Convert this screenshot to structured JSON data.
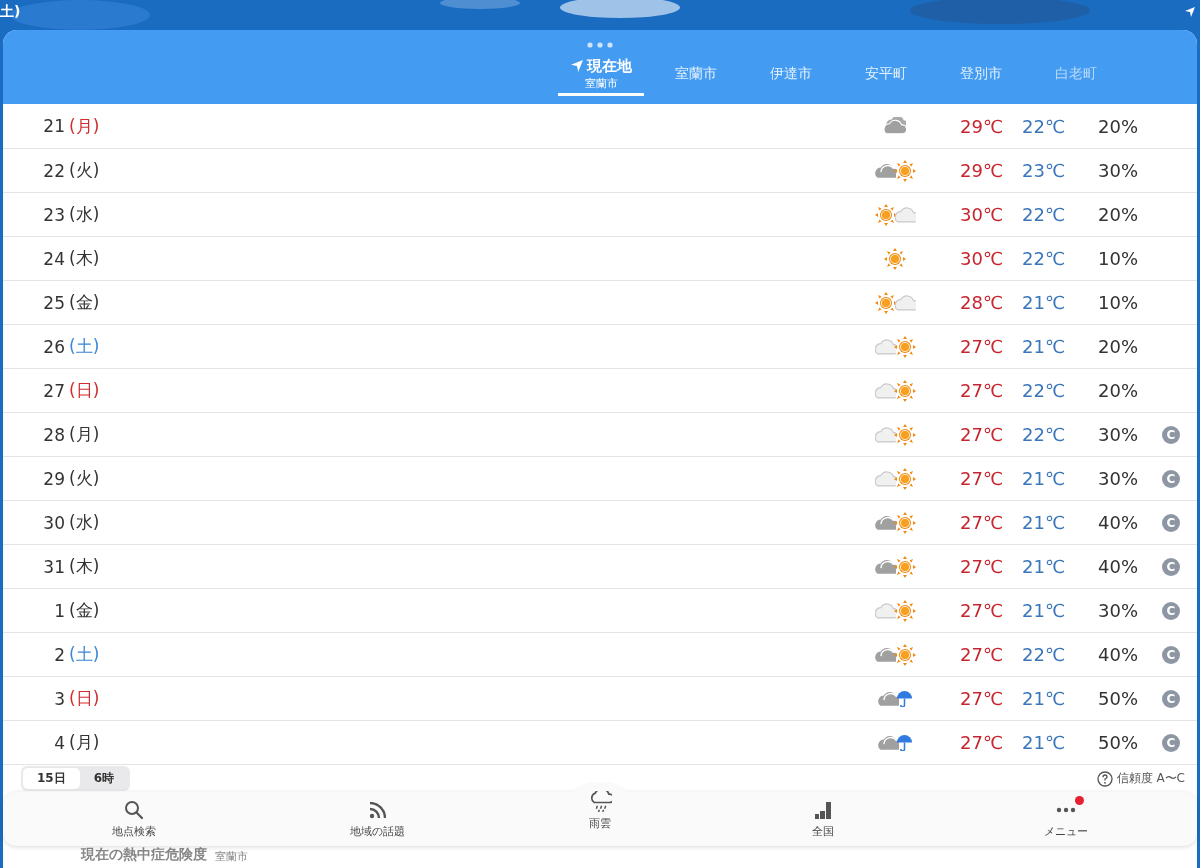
{
  "status_bar": {
    "left_text": "土)"
  },
  "header": {
    "tabs": [
      {
        "label": "現在地",
        "sublabel": "室蘭市",
        "current_location": true,
        "selected": true,
        "dimmed": false
      },
      {
        "label": "室蘭市",
        "current_location": false,
        "selected": false,
        "dimmed": false
      },
      {
        "label": "伊達市",
        "current_location": false,
        "selected": false,
        "dimmed": false
      },
      {
        "label": "安平町",
        "current_location": false,
        "selected": false,
        "dimmed": false
      },
      {
        "label": "登別市",
        "current_location": false,
        "selected": false,
        "dimmed": false
      },
      {
        "label": "白老町",
        "current_location": false,
        "selected": false,
        "dimmed": true
      }
    ]
  },
  "forecast": {
    "rows": [
      {
        "day": "21",
        "weekday": "(月)",
        "color": "#d22c2c",
        "weather": [
          {
            "kind": "clouds"
          }
        ],
        "high": "29℃",
        "low": "22℃",
        "precip": "20%"
      },
      {
        "day": "22",
        "weekday": "(火)",
        "color": "#333333",
        "weather": [
          {
            "kind": "cloud"
          },
          {
            "kind": "sun"
          }
        ],
        "high": "29℃",
        "low": "23℃",
        "precip": "30%"
      },
      {
        "day": "23",
        "weekday": "(水)",
        "color": "#333333",
        "weather": [
          {
            "kind": "sun"
          },
          {
            "kind": "pale_cloud"
          }
        ],
        "high": "30℃",
        "low": "22℃",
        "precip": "20%"
      },
      {
        "day": "24",
        "weekday": "(木)",
        "color": "#333333",
        "weather": [
          {
            "kind": "sun"
          }
        ],
        "high": "30℃",
        "low": "22℃",
        "precip": "10%"
      },
      {
        "day": "25",
        "weekday": "(金)",
        "color": "#333333",
        "weather": [
          {
            "kind": "sun"
          },
          {
            "kind": "pale_cloud"
          }
        ],
        "high": "28℃",
        "low": "21℃",
        "precip": "10%"
      },
      {
        "day": "26",
        "weekday": "(土)",
        "color": "#3b86d6",
        "weather": [
          {
            "kind": "pale_cloud"
          },
          {
            "kind": "sun"
          }
        ],
        "high": "27℃",
        "low": "21℃",
        "precip": "20%"
      },
      {
        "day": "27",
        "weekday": "(日)",
        "color": "#d22c2c",
        "weather": [
          {
            "kind": "pale_cloud"
          },
          {
            "kind": "sun"
          }
        ],
        "high": "27℃",
        "low": "22℃",
        "precip": "20%"
      },
      {
        "day": "28",
        "weekday": "(月)",
        "color": "#333333",
        "weather": [
          {
            "kind": "pale_cloud"
          },
          {
            "kind": "sun"
          }
        ],
        "high": "27℃",
        "low": "22℃",
        "precip": "30%",
        "reliability": "C"
      },
      {
        "day": "29",
        "weekday": "(火)",
        "color": "#333333",
        "weather": [
          {
            "kind": "pale_cloud"
          },
          {
            "kind": "sun"
          }
        ],
        "high": "27℃",
        "low": "21℃",
        "precip": "30%",
        "reliability": "C"
      },
      {
        "day": "30",
        "weekday": "(水)",
        "color": "#333333",
        "weather": [
          {
            "kind": "cloud"
          },
          {
            "kind": "sun"
          }
        ],
        "high": "27℃",
        "low": "21℃",
        "precip": "40%",
        "reliability": "C"
      },
      {
        "day": "31",
        "weekday": "(木)",
        "color": "#333333",
        "weather": [
          {
            "kind": "cloud"
          },
          {
            "kind": "sun"
          }
        ],
        "high": "27℃",
        "low": "21℃",
        "precip": "40%",
        "reliability": "C"
      },
      {
        "day": "1",
        "weekday": "(金)",
        "color": "#333333",
        "weather": [
          {
            "kind": "pale_cloud"
          },
          {
            "kind": "sun"
          }
        ],
        "high": "27℃",
        "low": "21℃",
        "precip": "30%",
        "reliability": "C"
      },
      {
        "day": "2",
        "weekday": "(土)",
        "color": "#3b86d6",
        "weather": [
          {
            "kind": "cloud"
          },
          {
            "kind": "sun"
          }
        ],
        "high": "27℃",
        "low": "22℃",
        "precip": "40%",
        "reliability": "C"
      },
      {
        "day": "3",
        "weekday": "(日)",
        "color": "#d22c2c",
        "weather": [
          {
            "kind": "cloud"
          },
          {
            "kind": "umbrella"
          }
        ],
        "high": "27℃",
        "low": "21℃",
        "precip": "50%",
        "reliability": "C"
      },
      {
        "day": "4",
        "weekday": "(月)",
        "color": "#333333",
        "weather": [
          {
            "kind": "cloud"
          },
          {
            "kind": "umbrella"
          }
        ],
        "high": "27℃",
        "low": "21℃",
        "precip": "50%",
        "reliability": "C"
      }
    ]
  },
  "footer": {
    "range_options": [
      {
        "label": "15日",
        "selected": true
      },
      {
        "label": "6時",
        "selected": false
      }
    ],
    "reliability_label": "信頼度 A〜C"
  },
  "heat_card": {
    "title": "現在の熱中症危険度",
    "place": "室蘭市"
  },
  "tab_bar": {
    "items": [
      {
        "label": "地点検索",
        "kind": "search",
        "badge": false
      },
      {
        "label": "地域の話題",
        "kind": "feed",
        "badge": false
      },
      {
        "label": "雨雲",
        "kind": "rain",
        "badge": false
      },
      {
        "label": "全国",
        "kind": "ranking",
        "badge": false
      },
      {
        "label": "メニュー",
        "kind": "more",
        "badge": true
      }
    ]
  }
}
